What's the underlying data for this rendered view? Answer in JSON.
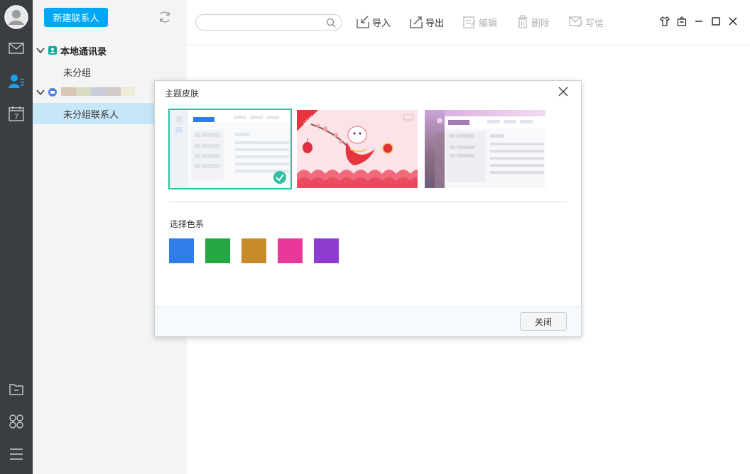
{
  "sidebar": {
    "new_contact_label": "新建联系人",
    "groups": [
      {
        "label": "本地通讯录",
        "sub": "未分组"
      },
      {
        "label": "",
        "sub": "未分组联系人"
      }
    ]
  },
  "toolbar": {
    "search_placeholder": "",
    "import_label": "导入",
    "export_label": "导出",
    "edit_label": "编辑",
    "delete_label": "删除",
    "write_label": "写信"
  },
  "modal": {
    "title": "主题皮肤",
    "themes": [
      {
        "name": "default-blue",
        "selected": true
      },
      {
        "name": "new-year",
        "badge": "NEW",
        "selected": false
      },
      {
        "name": "purple-landscape",
        "selected": false
      }
    ],
    "color_section_label": "选择色系",
    "swatches": [
      "#2f7ee8",
      "#24a843",
      "#c88b2a",
      "#e8399a",
      "#8d3ccf"
    ],
    "close_label": "关闭"
  },
  "colors": {
    "accent": "#00a7f5",
    "rail": "#3a3d42",
    "check": "#2bc2a0"
  },
  "calendar_day": "7"
}
